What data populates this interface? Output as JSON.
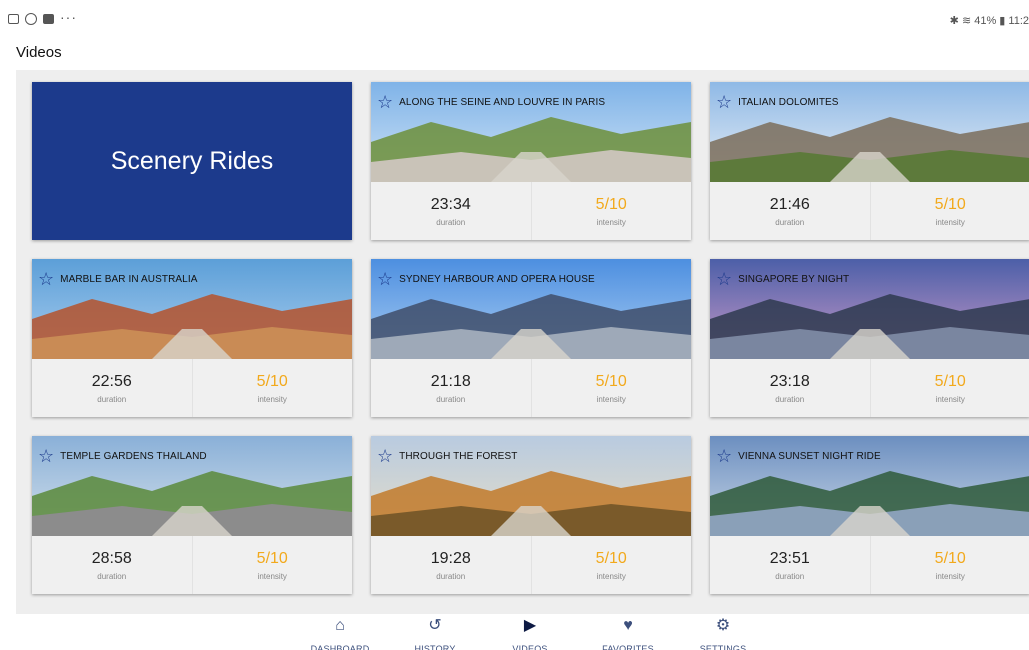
{
  "status_bar": {
    "dots": "···",
    "right_text": "✱ ≋ 41% ▮ 11:2"
  },
  "page_title": "Videos",
  "hero": {
    "label": "Scenery Rides",
    "color": "#1c3a8c"
  },
  "stat_labels": {
    "duration": "duration",
    "intensity": "intensity"
  },
  "accent_color": "#f2a91c",
  "rides": [
    {
      "title": "ALONG THE SEINE AND LOUVRE IN PARIS",
      "duration": "23:34",
      "intensity": "5/10",
      "favorite": false
    },
    {
      "title": "ITALIAN DOLOMITES",
      "duration": "21:46",
      "intensity": "5/10",
      "favorite": false
    },
    {
      "title": "MARBLE BAR IN AUSTRALIA",
      "duration": "22:56",
      "intensity": "5/10",
      "favorite": false
    },
    {
      "title": "SYDNEY HARBOUR AND OPERA HOUSE",
      "duration": "21:18",
      "intensity": "5/10",
      "favorite": false
    },
    {
      "title": "SINGAPORE BY NIGHT",
      "duration": "23:18",
      "intensity": "5/10",
      "favorite": false
    },
    {
      "title": "TEMPLE GARDENS THAILAND",
      "duration": "28:58",
      "intensity": "5/10",
      "favorite": false
    },
    {
      "title": "THROUGH THE FOREST",
      "duration": "19:28",
      "intensity": "5/10",
      "favorite": false
    },
    {
      "title": "VIENNA SUNSET NIGHT RIDE",
      "duration": "23:51",
      "intensity": "5/10",
      "favorite": false
    }
  ],
  "nav": [
    {
      "label": "DASHBOARD",
      "icon": "home-icon",
      "glyph": "⌂",
      "active": false
    },
    {
      "label": "HISTORY",
      "icon": "history-icon",
      "glyph": "↺",
      "active": false
    },
    {
      "label": "VIDEOS",
      "icon": "video-library-icon",
      "glyph": "▶",
      "active": true
    },
    {
      "label": "FAVORITES",
      "icon": "heart-icon",
      "glyph": "♥",
      "active": false
    },
    {
      "label": "SETTINGS",
      "icon": "gear-icon",
      "glyph": "⚙",
      "active": false
    }
  ]
}
